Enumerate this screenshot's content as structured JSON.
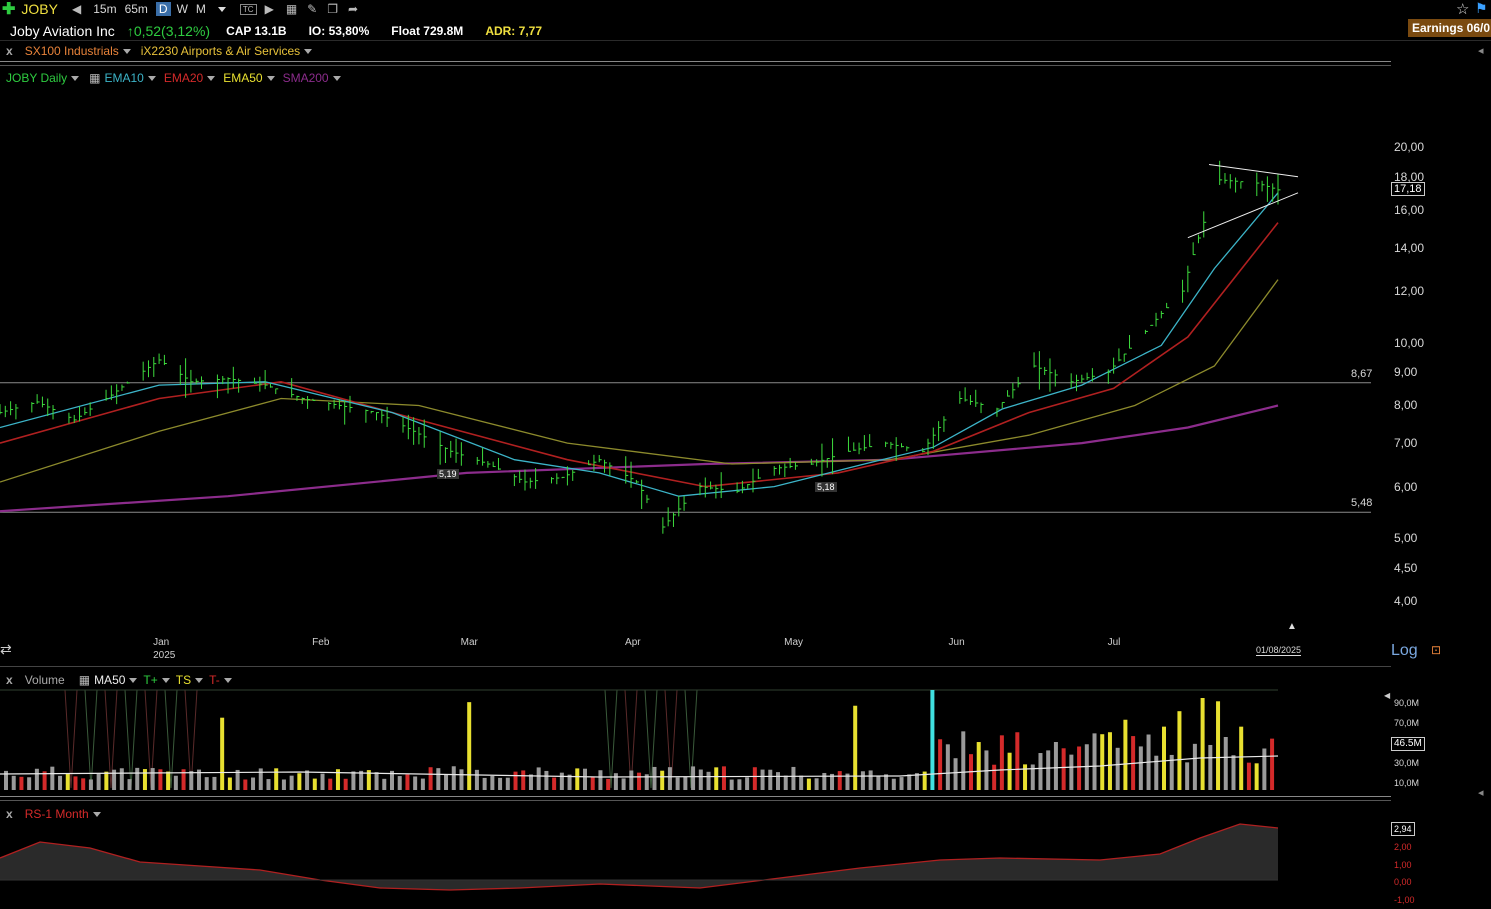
{
  "toolbar": {
    "ticker": "JOBY",
    "intervals": [
      "15m",
      "65m",
      "D",
      "W",
      "M"
    ],
    "active_interval": "D"
  },
  "header": {
    "company": "Joby Aviation Inc",
    "change": "0,52(3,12%)",
    "cap": "CAP 13.1B",
    "io": "IO: 53,80%",
    "float": "Float 729.8M",
    "adr": "ADR: 7,77",
    "earnings": "Earnings 06/0"
  },
  "groups": {
    "close": "x",
    "sector": "SX100 Industrials",
    "industry": "iX2230 Airports & Air Services"
  },
  "legend": {
    "series_name": "JOBY Daily",
    "indicators": [
      {
        "label": "EMA10",
        "color": "#3cb4c8"
      },
      {
        "label": "EMA20",
        "color": "#d42a2a"
      },
      {
        "label": "EMA50",
        "color": "#e8e030"
      },
      {
        "label": "SMA200",
        "color": "#8c2c8c"
      }
    ]
  },
  "price_panel": {
    "scale_label": "Log",
    "last_price": "17,18",
    "date_marker": "01/08/2025",
    "hline_high": "8,67",
    "hline_low": "5,48",
    "pivot_labels": [
      "5,19",
      "5,18"
    ]
  },
  "volume_panel": {
    "close": "x",
    "title": "Volume",
    "ma": "MA50",
    "t_plus": "T+",
    "ts": "TS",
    "t_minus": "T-",
    "current": "46.5M",
    "y_labels": [
      "90,0M",
      "70,0M",
      "50,0M",
      "30,0M",
      "10,0M"
    ]
  },
  "rs_panel": {
    "close": "x",
    "title": "RS-1 Month",
    "current": "2,94",
    "y_labels": [
      "2,00",
      "1,00",
      "0,00",
      "-1,00"
    ]
  },
  "chart_data": {
    "type": "line",
    "ylog": true,
    "ylim": [
      3.7,
      21.5
    ],
    "y_ticks": [
      "20,00",
      "18,00",
      "16,00",
      "14,00",
      "12,00",
      "10,00",
      "9,00",
      "8,00",
      "7,00",
      "6,00",
      "5,00",
      "4,50",
      "4,00"
    ],
    "y_tick_values": [
      20,
      18,
      16,
      14,
      12,
      10,
      9,
      8,
      7,
      6,
      5,
      4.5,
      4
    ],
    "x_labels": [
      "Jan\n2025",
      "Feb",
      "Mar",
      "Apr",
      "May",
      "Jun",
      "Jul"
    ],
    "x_label_dates": [
      "2025-01-02",
      "2025-02-01",
      "2025-03-01",
      "2025-04-01",
      "2025-05-01",
      "2025-06-01",
      "2025-07-01"
    ],
    "x_range": [
      "2024-12-03",
      "2025-08-01"
    ],
    "price": [
      [
        "2024-12-03",
        7.8
      ],
      [
        "2024-12-10",
        8.1
      ],
      [
        "2024-12-17",
        7.6
      ],
      [
        "2024-12-24",
        8.3
      ],
      [
        "2025-01-02",
        9.4
      ],
      [
        "2025-01-08",
        8.7
      ],
      [
        "2025-01-15",
        8.8
      ],
      [
        "2025-01-22",
        8.6
      ],
      [
        "2025-01-29",
        8.2
      ],
      [
        "2025-02-05",
        8.0
      ],
      [
        "2025-02-12",
        7.8
      ],
      [
        "2025-02-19",
        7.3
      ],
      [
        "2025-02-26",
        6.8
      ],
      [
        "2025-03-05",
        6.5
      ],
      [
        "2025-03-12",
        6.1
      ],
      [
        "2025-03-19",
        6.2
      ],
      [
        "2025-03-26",
        6.6
      ],
      [
        "2025-04-02",
        6.1
      ],
      [
        "2025-04-07",
        5.2
      ],
      [
        "2025-04-14",
        6.0
      ],
      [
        "2025-04-21",
        5.9
      ],
      [
        "2025-04-28",
        6.4
      ],
      [
        "2025-05-05",
        6.5
      ],
      [
        "2025-05-12",
        6.8
      ],
      [
        "2025-05-19",
        7.0
      ],
      [
        "2025-05-26",
        6.8
      ],
      [
        "2025-06-02",
        8.2
      ],
      [
        "2025-06-09",
        7.9
      ],
      [
        "2025-06-16",
        9.2
      ],
      [
        "2025-06-23",
        8.7
      ],
      [
        "2025-06-30",
        9.0
      ],
      [
        "2025-07-07",
        10.4
      ],
      [
        "2025-07-14",
        12.0
      ],
      [
        "2025-07-21",
        17.8
      ],
      [
        "2025-07-28",
        17.6
      ],
      [
        "2025-08-01",
        17.18
      ]
    ],
    "ema10": [
      [
        "2024-12-03",
        7.4
      ],
      [
        "2025-01-02",
        8.6
      ],
      [
        "2025-01-22",
        8.7
      ],
      [
        "2025-02-15",
        7.8
      ],
      [
        "2025-03-10",
        6.6
      ],
      [
        "2025-03-26",
        6.3
      ],
      [
        "2025-04-10",
        5.8
      ],
      [
        "2025-04-28",
        6.0
      ],
      [
        "2025-05-15",
        6.5
      ],
      [
        "2025-05-28",
        6.9
      ],
      [
        "2025-06-10",
        7.9
      ],
      [
        "2025-06-25",
        8.6
      ],
      [
        "2025-07-10",
        9.9
      ],
      [
        "2025-07-20",
        13.0
      ],
      [
        "2025-08-01",
        17.0
      ]
    ],
    "ema20": [
      [
        "2024-12-03",
        7.0
      ],
      [
        "2025-01-02",
        8.2
      ],
      [
        "2025-01-25",
        8.7
      ],
      [
        "2025-02-20",
        7.6
      ],
      [
        "2025-03-20",
        6.6
      ],
      [
        "2025-04-15",
        6.0
      ],
      [
        "2025-05-10",
        6.3
      ],
      [
        "2025-05-28",
        6.8
      ],
      [
        "2025-06-15",
        7.8
      ],
      [
        "2025-07-01",
        8.5
      ],
      [
        "2025-07-15",
        10.2
      ],
      [
        "2025-08-01",
        15.3
      ]
    ],
    "ema50": [
      [
        "2024-12-03",
        6.1
      ],
      [
        "2025-01-02",
        7.3
      ],
      [
        "2025-01-25",
        8.2
      ],
      [
        "2025-02-20",
        8.0
      ],
      [
        "2025-03-20",
        7.0
      ],
      [
        "2025-04-20",
        6.5
      ],
      [
        "2025-05-20",
        6.6
      ],
      [
        "2025-06-15",
        7.2
      ],
      [
        "2025-07-05",
        8.0
      ],
      [
        "2025-07-20",
        9.2
      ],
      [
        "2025-08-01",
        12.5
      ]
    ],
    "sma200": [
      [
        "2024-12-03",
        5.5
      ],
      [
        "2025-01-15",
        5.8
      ],
      [
        "2025-03-01",
        6.3
      ],
      [
        "2025-04-15",
        6.5
      ],
      [
        "2025-05-20",
        6.6
      ],
      [
        "2025-06-25",
        7.0
      ],
      [
        "2025-07-15",
        7.4
      ],
      [
        "2025-08-01",
        8.0
      ]
    ],
    "hlines": [
      8.67,
      5.48
    ],
    "pennant": {
      "upper": [
        [
          "2025-07-19",
          18.8
        ],
        [
          "2025-08-01",
          18.0
        ]
      ],
      "lower": [
        [
          "2025-07-15",
          14.5
        ],
        [
          "2025-08-01",
          17.0
        ]
      ]
    }
  }
}
